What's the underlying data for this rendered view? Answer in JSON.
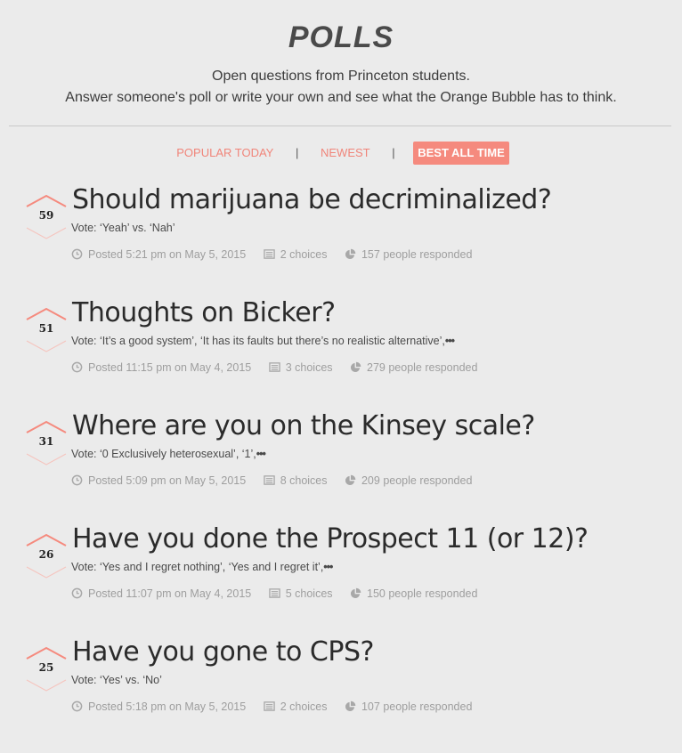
{
  "header": {
    "title": "POLLS",
    "subtitle_line1": "Open questions from Princeton students.",
    "subtitle_line2": "Answer someone's poll or write your own and see what the Orange Bubble has to think."
  },
  "tabs": [
    {
      "label": "POPULAR TODAY",
      "active": false
    },
    {
      "label": "NEWEST",
      "active": false
    },
    {
      "label": "BEST ALL TIME",
      "active": true
    }
  ],
  "tab_separator": "|",
  "colors": {
    "accent": "#f58a7e",
    "background": "#ebebeb"
  },
  "polls": [
    {
      "votes": "59",
      "question": "Should marijuana be decriminalized?",
      "options": "Vote: ‘Yeah’ vs. ‘Nah’",
      "truncated": false,
      "posted": "Posted 5:21 pm on May 5, 2015",
      "choices": "2 choices",
      "responses": "157 people responded"
    },
    {
      "votes": "51",
      "question": "Thoughts on Bicker?",
      "options": "Vote: ‘It’s a good system’, ‘It has its faults but there’s no realistic alternative’,",
      "truncated": true,
      "posted": "Posted 11:15 pm on May 4, 2015",
      "choices": "3 choices",
      "responses": "279 people responded"
    },
    {
      "votes": "31",
      "question": "Where are you on the Kinsey scale?",
      "options": "Vote: ‘0 Exclusively heterosexual’, ‘1’,",
      "truncated": true,
      "posted": "Posted 5:09 pm on May 5, 2015",
      "choices": "8 choices",
      "responses": "209 people responded"
    },
    {
      "votes": "26",
      "question": "Have you done the Prospect 11 (or 12)?",
      "options": "Vote: ‘Yes and I regret nothing’, ‘Yes and I regret it’,",
      "truncated": true,
      "posted": "Posted 11:07 pm on May 4, 2015",
      "choices": "5 choices",
      "responses": "150 people responded"
    },
    {
      "votes": "25",
      "question": "Have you gone to CPS?",
      "options": "Vote: ‘Yes’ vs. ‘No’",
      "truncated": false,
      "posted": "Posted 5:18 pm on May 5, 2015",
      "choices": "2 choices",
      "responses": "107 people responded"
    }
  ],
  "ellipsis_glyph": "•••",
  "icons": {
    "posted": "clock-icon",
    "choices": "list-icon",
    "responses": "pie-chart-icon",
    "upvote": "upvote-arrow-icon",
    "downvote": "downvote-arrow-icon"
  }
}
